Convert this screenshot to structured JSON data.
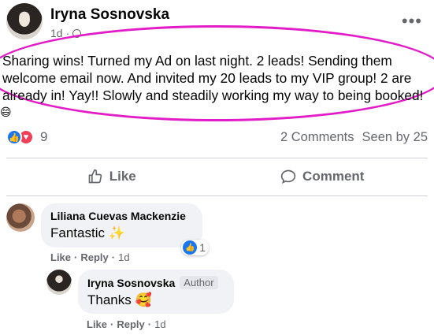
{
  "post": {
    "author": "Iryna Sosnovska",
    "time": "1d",
    "text": "Sharing wins! Turned my Ad on last night. 2 leads! Sending them welcome email now. And invited my 20 leads to my VIP group! 2 are already in! Yay!! Slowly and steadily working my way to being booked!",
    "reaction_count": "9",
    "comments_count": "2 Comments",
    "seen_by": "Seen by 25"
  },
  "actions": {
    "like_label": "Like",
    "comment_label": "Comment"
  },
  "comments": [
    {
      "author": "Liliana Cuevas Mackenzie",
      "text": "Fantastic ✨",
      "like_action": "Like",
      "reply_action": "Reply",
      "time": "1d",
      "reaction_count": "1"
    },
    {
      "author": "Iryna Sosnovska",
      "badge": "Author",
      "text": "Thanks 🥰",
      "like_action": "Like",
      "reply_action": "Reply",
      "time": "1d"
    }
  ],
  "colors": {
    "highlight": "#e21cc7",
    "like_blue": "#1877f2",
    "love_red": "#f33e58",
    "secondary_text": "#65676b"
  }
}
